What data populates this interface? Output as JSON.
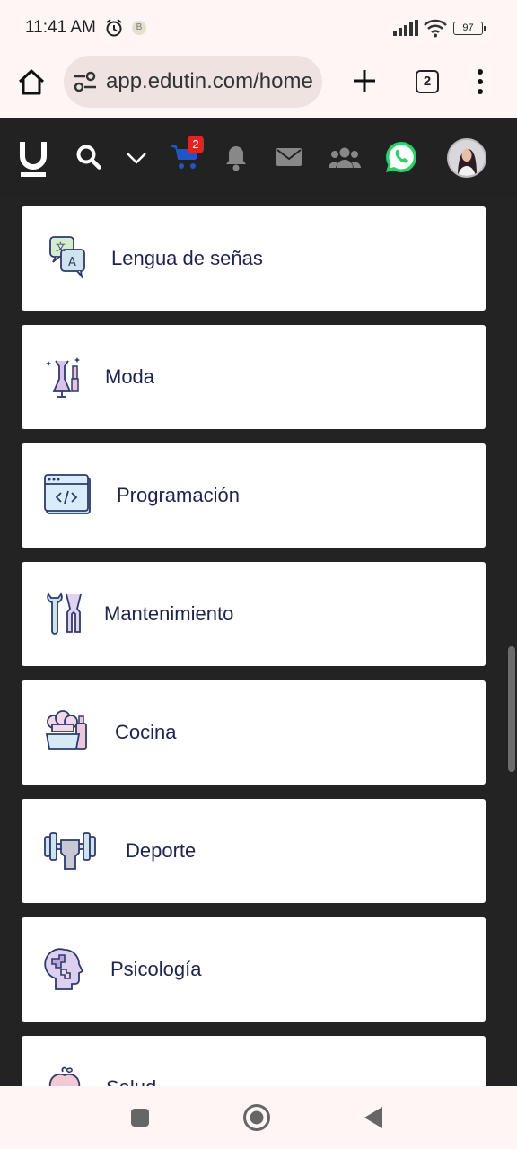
{
  "status_bar": {
    "time": "11:41 AM",
    "b_badge": "B",
    "battery": "97",
    "icons": [
      "alarm-icon",
      "signal-icon",
      "wifi-icon",
      "battery-icon"
    ]
  },
  "browser": {
    "url": "app.edutin.com/home",
    "tab_count": "2",
    "icons": [
      "home-icon",
      "site-info-icon",
      "plus-icon",
      "tab-switcher-icon",
      "more-vert-icon"
    ]
  },
  "app_header": {
    "cart_count": "2",
    "icons": [
      "edutin-logo",
      "search-icon",
      "chevron-down-icon",
      "cart-icon",
      "bell-icon",
      "mail-icon",
      "users-icon",
      "whatsapp-icon",
      "avatar"
    ],
    "colors": {
      "background": "#222222",
      "cart": "#1f55c7",
      "badge": "#e02424",
      "whatsapp": "#25d366"
    }
  },
  "categories": [
    {
      "label": "Lengua de señas",
      "icon": "sign-language-icon"
    },
    {
      "label": "Moda",
      "icon": "fashion-icon"
    },
    {
      "label": "Programación",
      "icon": "programming-icon"
    },
    {
      "label": "Mantenimiento",
      "icon": "tools-icon"
    },
    {
      "label": "Cocina",
      "icon": "cooking-icon"
    },
    {
      "label": "Deporte",
      "icon": "dumbbell-icon"
    },
    {
      "label": "Psicología",
      "icon": "psychology-icon"
    },
    {
      "label": "Salud",
      "icon": "health-icon"
    }
  ],
  "nav_bar": {
    "icons": [
      "recents-icon",
      "home-circle-icon",
      "back-icon"
    ]
  }
}
